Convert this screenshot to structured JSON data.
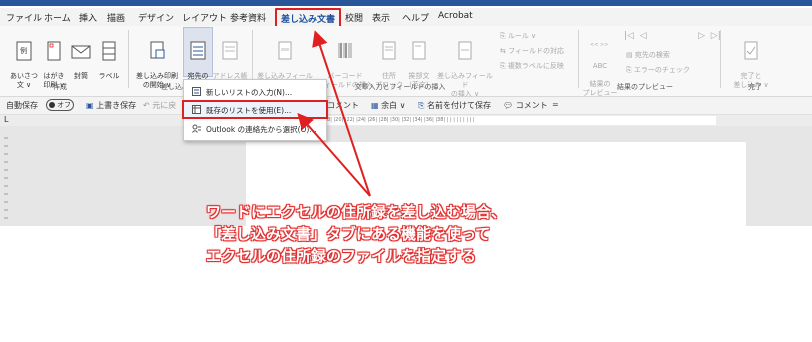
{
  "tabs": [
    {
      "label": "ファイル"
    },
    {
      "label": "ホーム"
    },
    {
      "label": "挿入"
    },
    {
      "label": "描画"
    },
    {
      "label": "デザイン"
    },
    {
      "label": "レイアウト"
    },
    {
      "label": "参考資料"
    },
    {
      "label": "差し込み文書"
    },
    {
      "label": "校閲"
    },
    {
      "label": "表示"
    },
    {
      "label": "ヘルプ"
    },
    {
      "label": "Acrobat"
    }
  ],
  "ribbon": {
    "create": {
      "envelope": "あいさつ\n文 ∨",
      "postcard": "はがき\n印刷 ∨",
      "envelopes": "封筒",
      "labels": "ラベル",
      "group": "作成"
    },
    "start": {
      "start_merge": "差し込み印刷\nの開始 ∨",
      "select_recipients": "宛先の\n選択 ∨",
      "edit_list": "アドレス帳\nの編集",
      "group": "差し込み"
    },
    "fields": {
      "highlight": "差し込みフィールド\nの強調表示",
      "barcode": "バーコード\nフィールドの挿入",
      "address_block": "住所\nブロック",
      "greeting": "挨拶文\n(英文)",
      "insert_field": "差し込みフィールド\nの挿入 ∨",
      "rules": "ルール ∨",
      "match_fields": "フィールドの対応",
      "update_labels": "複数ラベルに反映",
      "group": "文章入力とフィールドの挿入"
    },
    "preview": {
      "abc": "ABC",
      "preview_btn": "結果の\nプレビュー",
      "find": "宛先の検索",
      "check": "エラーのチェック",
      "group": "結果のプレビュー"
    },
    "finish": {
      "finish_btn": "完了と\n差し込み ∨",
      "group": "完了"
    }
  },
  "qat": {
    "autosave": "自動保存",
    "toggle": "オフ",
    "overwrite": "上書き保存",
    "undo": "元に戻",
    "field_insert": "フィールドの挿入",
    "comment": "コメント",
    "margin": "余白 ∨",
    "saveas": "名前を付けて保存",
    "comment2": "コメント",
    "more": "="
  },
  "ruler_text": "2| |4| |6| |8| |10| |12| |14| |16| |18| |20| |22| |24| |26| |28| |30| |32| |34| |36| |38| | | | | | | | | |",
  "dropdown": {
    "new_list": "新しいリストの入力(N)...",
    "existing_list": "既存のリストを使用(E)...",
    "outlook": "Outlook の連絡先から選択(O)..."
  },
  "annotation": {
    "line1": "ワードにエクセルの住所録を差し込む場合、",
    "line2": "「差し込み文書」タブにある機能を使って",
    "line3": "エクセルの住所録のファイルを指定する"
  },
  "colors": {
    "accent": "#2b579a",
    "highlight": "#e02020"
  }
}
